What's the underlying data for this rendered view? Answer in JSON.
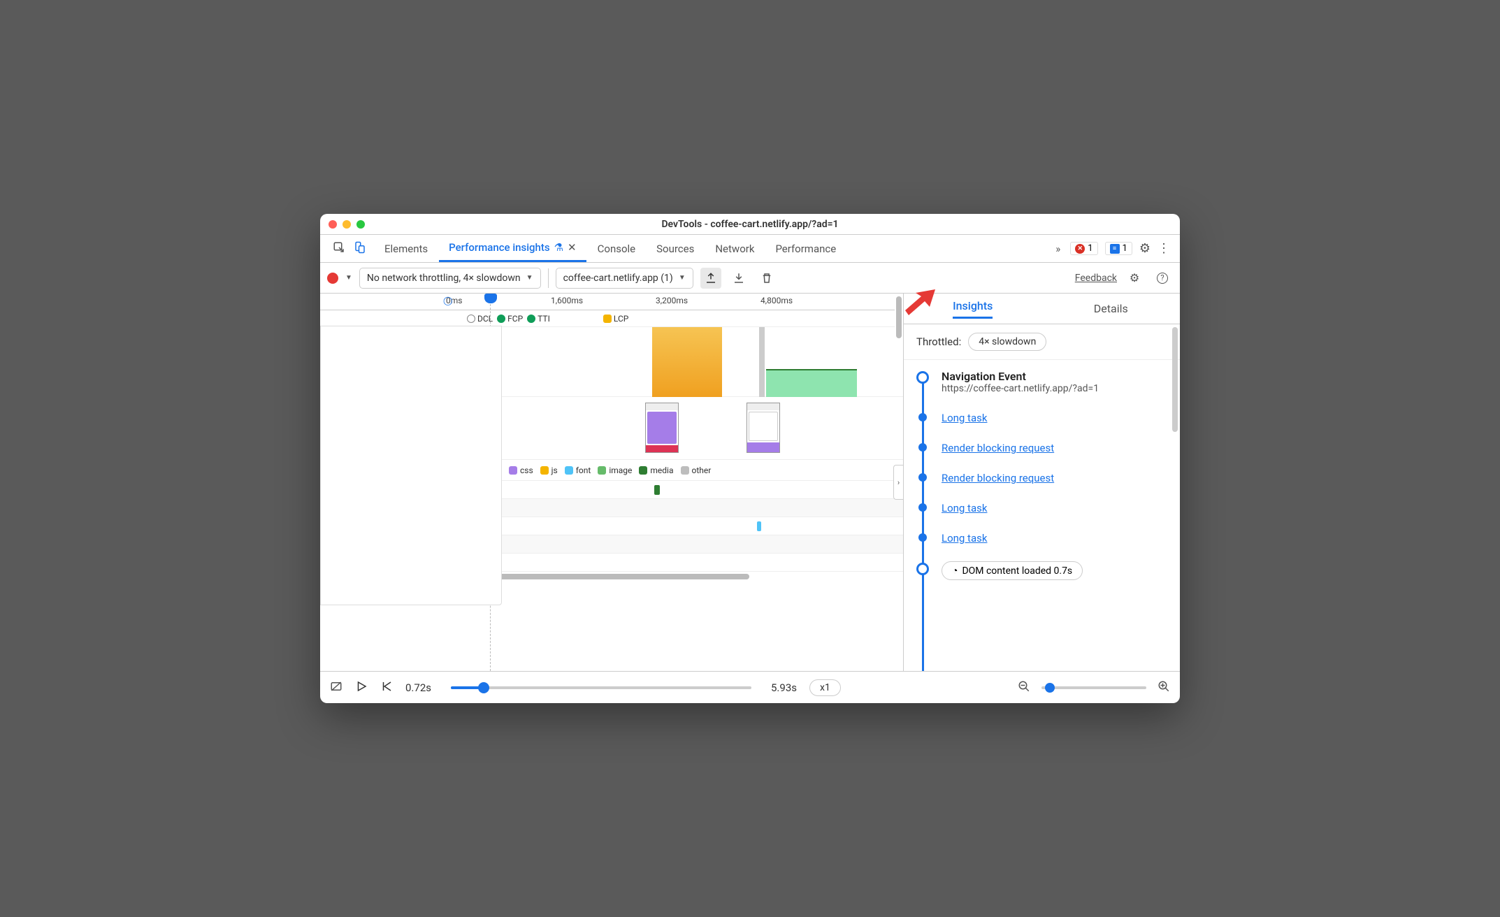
{
  "window": {
    "title": "DevTools - coffee-cart.netlify.app/?ad=1"
  },
  "tabs": {
    "items": [
      "Elements",
      "Performance insights",
      "Console",
      "Sources",
      "Network",
      "Performance"
    ],
    "active_index": 1,
    "overflow_glyph": "»",
    "error_count": "1",
    "warning_count": "1"
  },
  "toolbar": {
    "throttle_label": "No network throttling, 4× slowdown",
    "recording_label": "coffee-cart.netlify.app (1)",
    "feedback_label": "Feedback"
  },
  "ruler": {
    "ticks": [
      "0ms",
      "1,600ms",
      "3,200ms",
      "4,800ms"
    ]
  },
  "markers": {
    "items": [
      {
        "label": "DCL",
        "color": "#ffffff",
        "border": "#888"
      },
      {
        "label": "FCP",
        "color": "#0f9d58"
      },
      {
        "label": "TTI",
        "color": "#0f9d58"
      },
      {
        "label": "LCP",
        "color": "#f4b400"
      }
    ]
  },
  "legend": {
    "items": [
      {
        "label": "css",
        "color": "#a57de8"
      },
      {
        "label": "js",
        "color": "#f4b400"
      },
      {
        "label": "font",
        "color": "#4fc3f7"
      },
      {
        "label": "image",
        "color": "#66bb6a"
      },
      {
        "label": "media",
        "color": "#2e7d32"
      },
      {
        "label": "other",
        "color": "#bdbdbd"
      }
    ]
  },
  "right": {
    "tabs": [
      "Insights",
      "Details"
    ],
    "active": 0,
    "throttled_label": "Throttled:",
    "throttled_value": "4× slowdown",
    "nav_event": {
      "title": "Navigation Event",
      "url": "https://coffee-cart.netlify.app/?ad=1"
    },
    "items": [
      "Long task",
      "Render blocking request",
      "Render blocking request",
      "Long task",
      "Long task"
    ],
    "dom_item": "DOM content loaded 0.7s"
  },
  "bottom": {
    "time_start": "0.72s",
    "time_end": "5.93s",
    "speed": "x1"
  }
}
